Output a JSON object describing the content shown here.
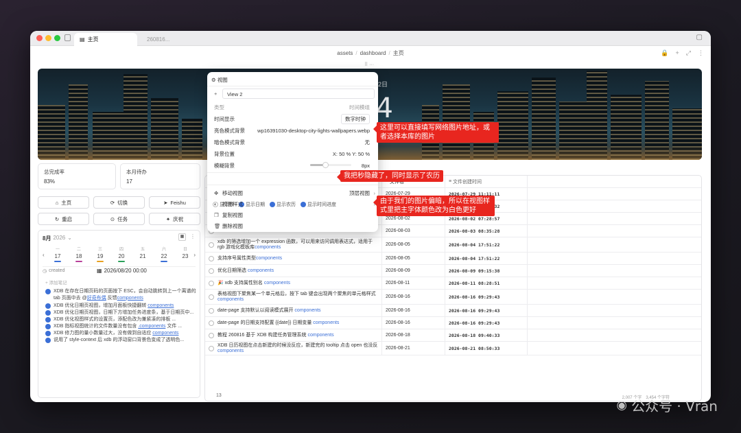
{
  "tabs": [
    {
      "label": "主页"
    },
    {
      "label": "260816..."
    }
  ],
  "breadcrumb": [
    "assets",
    "/",
    "dashboard",
    "/",
    "主页"
  ],
  "banner": {
    "date": "22日",
    "clock": "44"
  },
  "stats": [
    {
      "label": "总完成率",
      "value": "83%"
    },
    {
      "label": "本月待办",
      "value": "17"
    }
  ],
  "buttons": [
    {
      "label": "主页",
      "icon": "home-icon",
      "glyph": "⌂"
    },
    {
      "label": "切换",
      "icon": "switch-icon",
      "glyph": "⟳"
    },
    {
      "label": "Feishu",
      "icon": "send-icon",
      "glyph": "➤"
    },
    {
      "label": "重启",
      "icon": "restart-icon",
      "glyph": "↻"
    },
    {
      "label": "任务",
      "icon": "task-icon",
      "glyph": "⊙"
    },
    {
      "label": "庆祝",
      "icon": "celebrate-icon",
      "glyph": "✦"
    }
  ],
  "calendar": {
    "month": "8月",
    "year": "2026",
    "days": [
      {
        "w": "一",
        "n": "17",
        "color": "#3b6fd6"
      },
      {
        "w": "二",
        "n": "18",
        "color": "#b8409a"
      },
      {
        "w": "三",
        "n": "19",
        "color": "#e8a020"
      },
      {
        "w": "四",
        "n": "20",
        "color": "#2aa05a"
      },
      {
        "w": "五",
        "n": "21",
        "color": ""
      },
      {
        "w": "六",
        "n": "22",
        "color": "#3b6fd6"
      },
      {
        "w": "日",
        "n": "23",
        "color": ""
      }
    ],
    "created_label": "created",
    "created_value": "2026/08/20 00:00",
    "add_note": "添加笔记",
    "tasks": [
      {
        "text": "XDB 在存在日期页码的页面按下 ESC，会自动跳转到上一个离谱的 tab 页面中去 @",
        "link": "好奇布偶",
        "after": " 反馈",
        "link2": "components"
      },
      {
        "text": "XDB 优化日期页视图，增加月面板快捷翻转 ",
        "link": "components",
        "after": "",
        "link2": ""
      },
      {
        "text": "XDB 优化日期页视图，日期下方增加任务进度条，基于日期页中...",
        "link": "",
        "after": "",
        "link2": ""
      },
      {
        "text": "XDB 优化视图样式的设置页，添配色改为兼紧凑的排板 ...",
        "link": "",
        "after": "",
        "link2": ""
      },
      {
        "text": "XDB 指标视图统计的文件数量没有包含 ",
        "link": ".components",
        "after": " 文件 ...",
        "link2": ""
      },
      {
        "text": "XDB 修力图的量小数量过大，没有做到自适应 ",
        "link": "components",
        "after": "",
        "link2": ""
      },
      {
        "text": "说用了 style-context 后 xdb 的浮动窗口背景色变成了透明色...",
        "link": "",
        "after": "",
        "link2": ""
      }
    ]
  },
  "popup": {
    "title": "视图",
    "view_name": "View 2",
    "rows": [
      {
        "label": "类型",
        "value": "时间模组"
      },
      {
        "label": "时间显示",
        "value": "数字时钟"
      },
      {
        "label": "亮色模式背景",
        "value": "wp16391030-desktop-city-lights-wallpapers.webp"
      },
      {
        "label": "暗色模式背景",
        "value": "无"
      },
      {
        "label": "背景位置",
        "value": "X: 50 % Y: 50 %"
      },
      {
        "label": "模糊背景",
        "value": "8px"
      }
    ],
    "toggles": [
      "显示秒",
      "显示日期",
      "显示农历",
      "显示时间进度"
    ],
    "menu": [
      {
        "label": "移动视图",
        "value": "顶层视图",
        "icon": "move-icon",
        "glyph": "✥"
      },
      {
        "label": "视图样式",
        "value": "",
        "icon": "palette-icon",
        "glyph": "◐"
      },
      {
        "label": "复制视图",
        "value": "",
        "icon": "copy-icon",
        "glyph": "❐"
      },
      {
        "label": "删除视图",
        "value": "",
        "icon": "trash-icon",
        "glyph": "🗑"
      }
    ]
  },
  "annotations": [
    "这里可以直接填写网络图片地址，或者选择本库的图片",
    "我把秒隐藏了，同时显示了农历",
    "由于我们的图片偏暗，所以在视图样式里把主字体颜色改为白色更好"
  ],
  "table": {
    "headers": [
      "",
      "文件名",
      "文件创建时间"
    ],
    "rows": [
      {
        "title": "",
        "comp": "",
        "date": "2026-07-29",
        "time": "2026-07-29 11:11:11"
      },
      {
        "title": "",
        "comp": "",
        "date": "2026-07-31",
        "time": "2026-07-31 07:35:32"
      },
      {
        "title": "",
        "comp": "",
        "date": "2026-08-02",
        "time": "2026-08-02 07:28:57"
      },
      {
        "title": "",
        "comp": "",
        "date": "2026-08-03",
        "time": "2026-08-03 08:35:28"
      },
      {
        "title": "xdb 的筛选增加一个 expression 函数，可以用来访问调用表达式，适用于 rgb 游戏化模板库",
        "comp": "components",
        "date": "2026-08-05",
        "time": "2026-08-04 17:51:22"
      },
      {
        "title": "支持序号属性类型",
        "comp": "components",
        "date": "2026-08-05",
        "time": "2026-08-04 17:51:22"
      },
      {
        "title": "优化日期筛选 ",
        "comp": "components",
        "date": "2026-08-09",
        "time": "2026-08-09 09:15:38"
      },
      {
        "title": "🎉 xdb 支持属性别名 ",
        "comp": "components",
        "date": "2026-08-11",
        "time": "2026-08-11 08:28:51"
      },
      {
        "title": "表格视图下聚焦某一个单元格后，按下 tab 键会出现两个聚焦的单元格样式",
        "comp": "components",
        "date": "2026-08-16",
        "time": "2026-08-16 09:29:43"
      },
      {
        "title": "date-page 支持默认以阅读模式展开 ",
        "comp": "components",
        "date": "2026-08-16",
        "time": "2026-08-16 09:29:43"
      },
      {
        "title": "date-page 的日期支持配置 {{date}} 日期变量 ",
        "comp": "components",
        "date": "2026-08-16",
        "time": "2026-08-16 09:29:43"
      },
      {
        "title": "教程 260816 基于 XDB 构建任务管理系统 ",
        "comp": "components",
        "date": "2026-08-18",
        "time": "2026-08-18 09:40:33"
      },
      {
        "title": "XDB 日历视图在点击新建的时候没反应，新建完的 tooltip 点击 open 也没反",
        "comp": "components",
        "date": "2026-08-21",
        "time": "2026-08-21 08:50:33"
      }
    ],
    "footer_count": "13"
  },
  "statusbar": {
    "backlinks": "2,007 个字",
    "chars": "3,454 个字符"
  },
  "watermark": {
    "text": "公众号 · Vran"
  }
}
